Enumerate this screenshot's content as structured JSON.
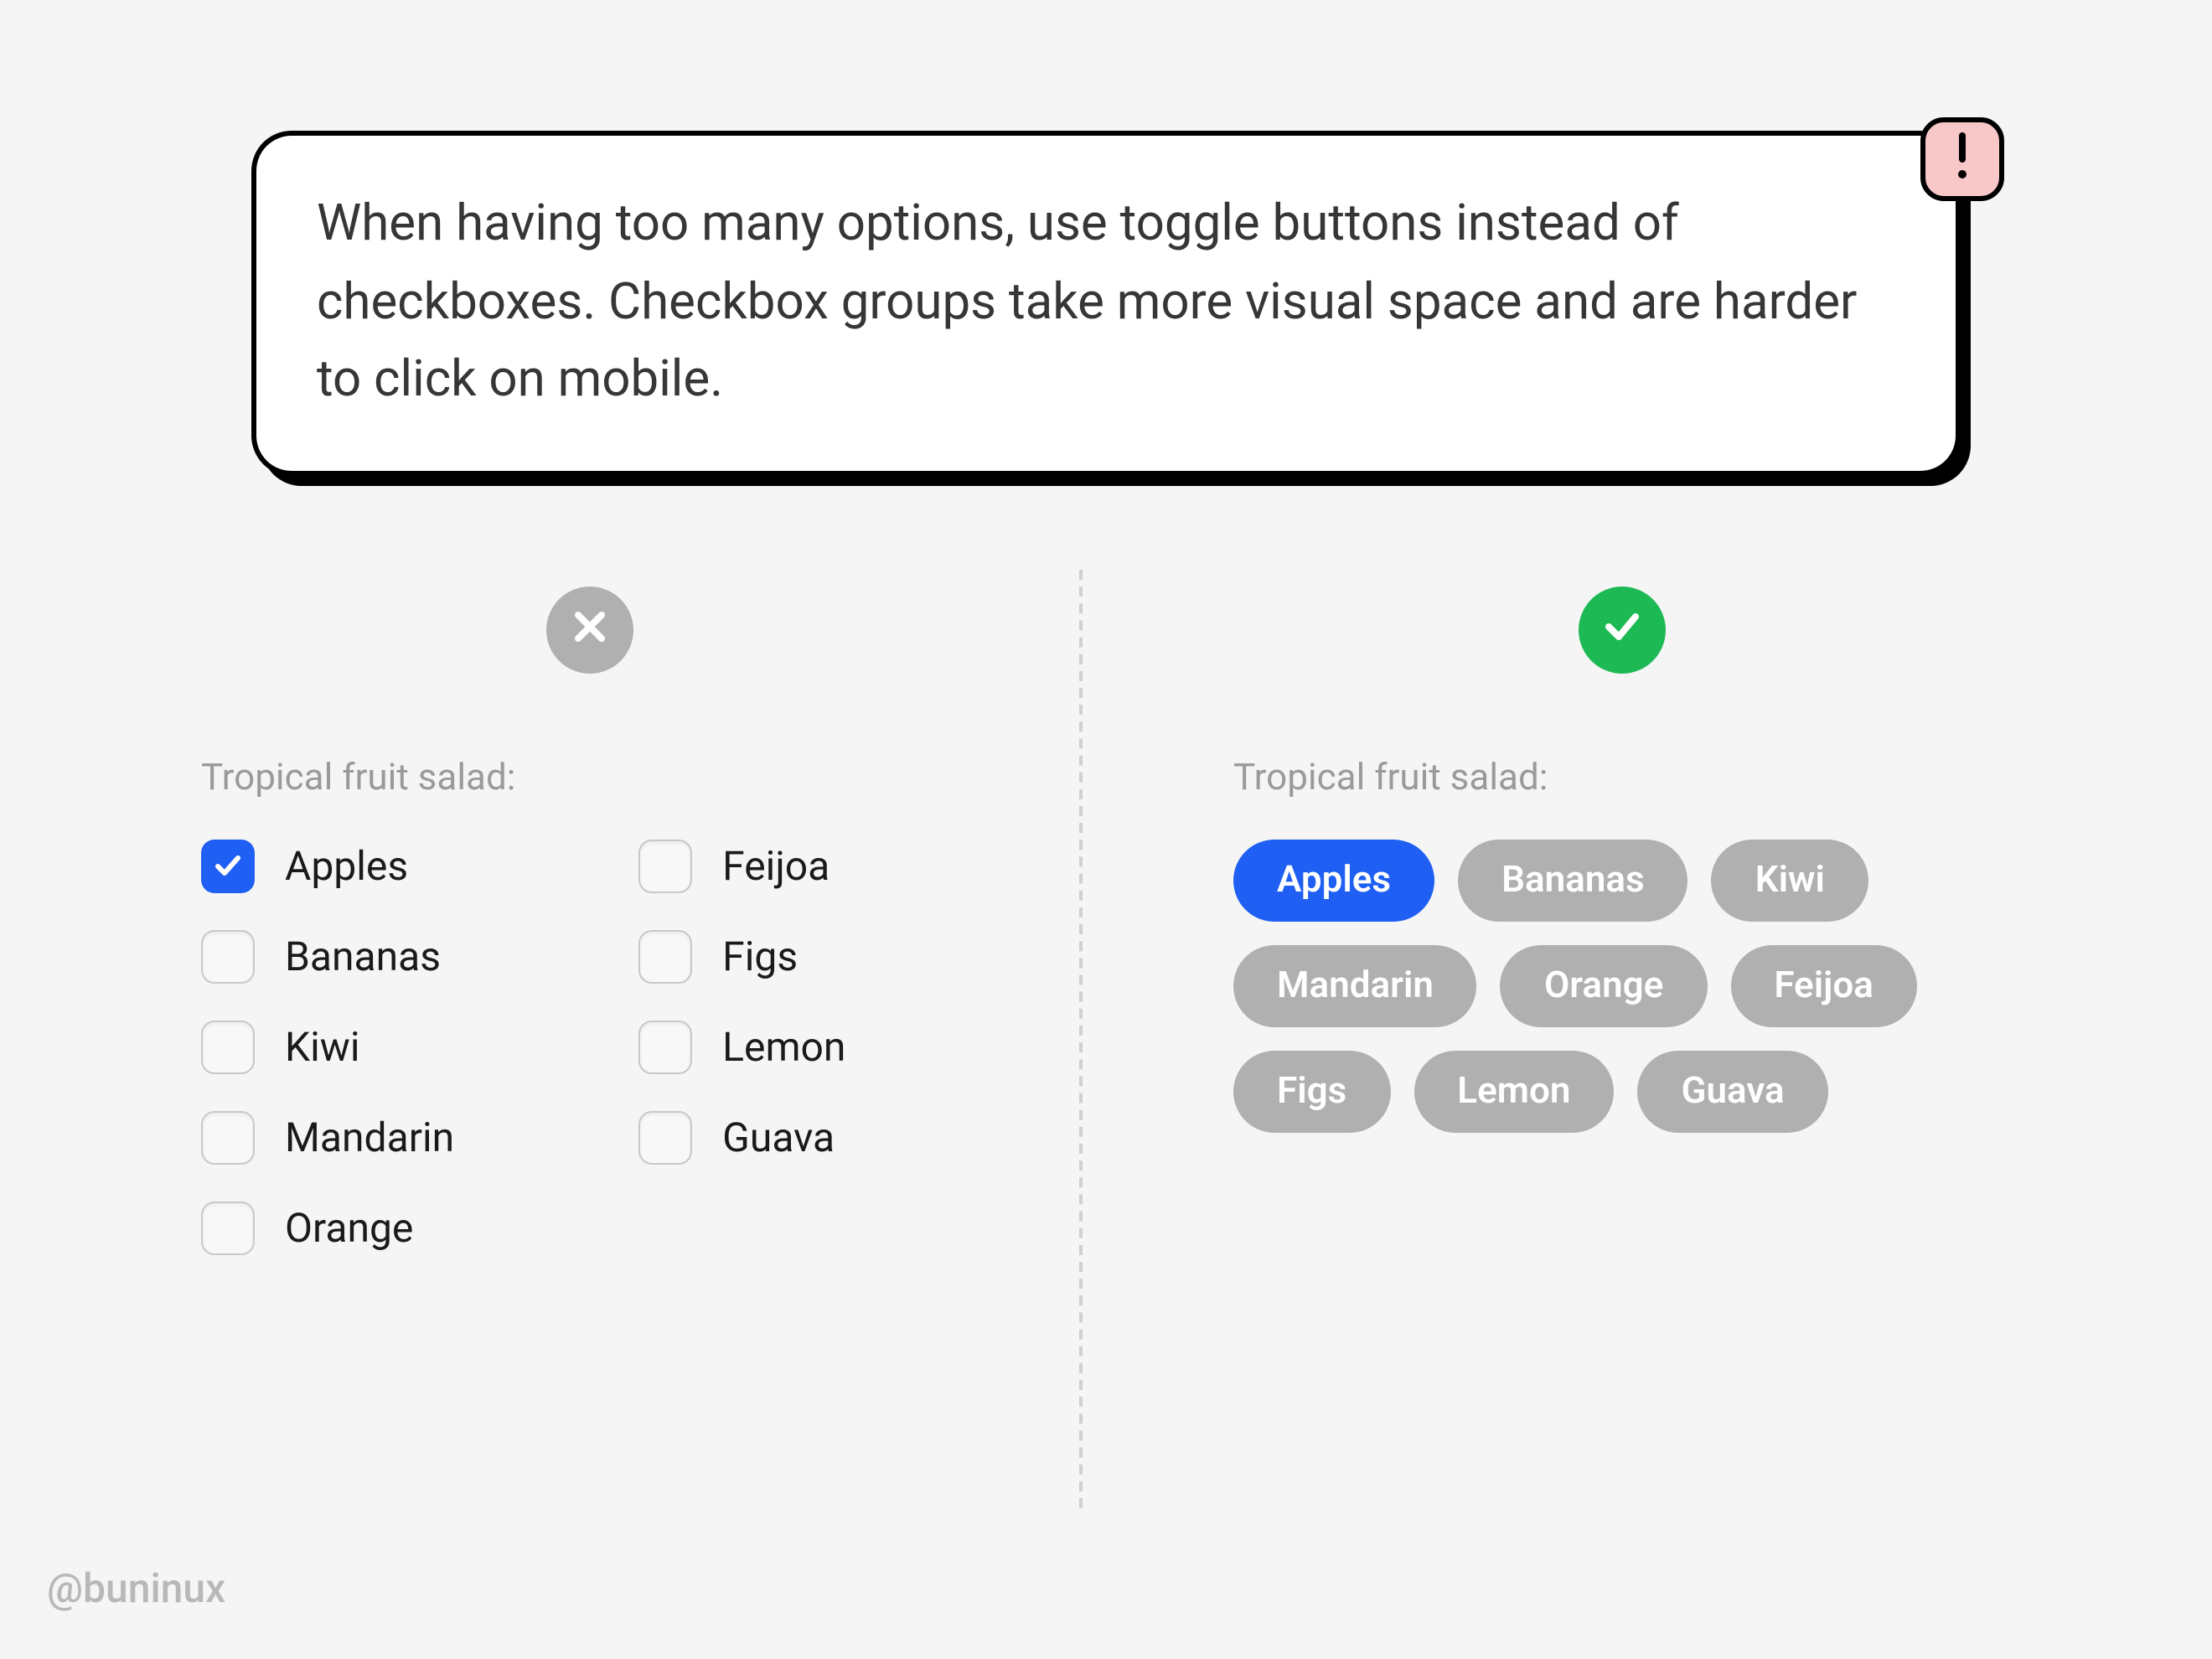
{
  "tip": {
    "text": "When having too many options, use toggle buttons instead of checkboxes. Checkbox groups take more visual space and are harder to click on mobile."
  },
  "bad": {
    "label": "Tropical fruit salad:",
    "col1": [
      {
        "label": "Apples",
        "checked": true
      },
      {
        "label": "Bananas",
        "checked": false
      },
      {
        "label": "Kiwi",
        "checked": false
      },
      {
        "label": "Mandarin",
        "checked": false
      },
      {
        "label": "Orange",
        "checked": false
      }
    ],
    "col2": [
      {
        "label": "Feijoa",
        "checked": false
      },
      {
        "label": "Figs",
        "checked": false
      },
      {
        "label": "Lemon",
        "checked": false
      },
      {
        "label": "Guava",
        "checked": false
      }
    ]
  },
  "good": {
    "label": "Tropical fruit salad:",
    "chips": [
      {
        "label": "Apples",
        "selected": true
      },
      {
        "label": "Bananas",
        "selected": false
      },
      {
        "label": "Kiwi",
        "selected": false
      },
      {
        "label": "Mandarin",
        "selected": false
      },
      {
        "label": "Orange",
        "selected": false
      },
      {
        "label": "Feijoa",
        "selected": false
      },
      {
        "label": "Figs",
        "selected": false
      },
      {
        "label": "Lemon",
        "selected": false
      },
      {
        "label": "Guava",
        "selected": false
      }
    ]
  },
  "handle": "@buninux"
}
